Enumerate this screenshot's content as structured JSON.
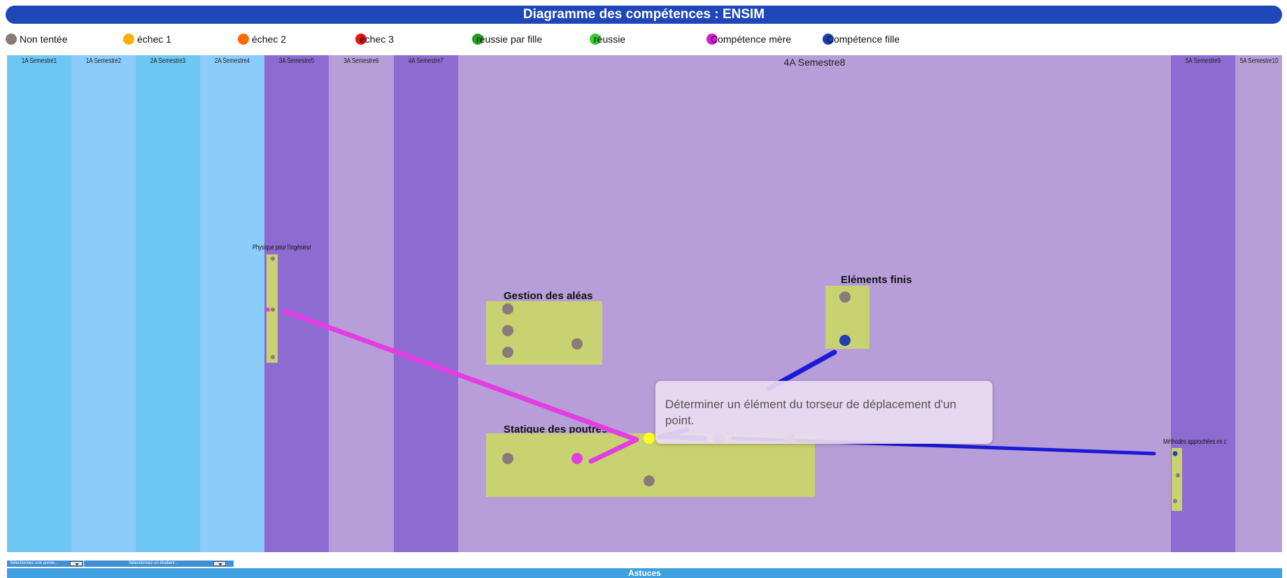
{
  "app": {
    "title": "Diagramme des compétences : ENSIM"
  },
  "legend": [
    {
      "label": "Non tentée",
      "color": "#8a7a78"
    },
    {
      "label": "échec 1",
      "color": "#ffb000"
    },
    {
      "label": "échec 2",
      "color": "#ff6a00"
    },
    {
      "label": "échec 3",
      "color": "#ee1111"
    },
    {
      "label": "réussie par fille",
      "color": "#22a020"
    },
    {
      "label": "réussie",
      "color": "#33cc33"
    },
    {
      "label": "Compétence mère",
      "color": "#d11ed1"
    },
    {
      "label": "Compétence fille",
      "color": "#1f3fb0"
    }
  ],
  "semesters": [
    {
      "label": "1A Semestre1",
      "color": "#6ec6f2"
    },
    {
      "label": "1A Semestre2",
      "color": "#8cccfb"
    },
    {
      "label": "2A Semestre3",
      "color": "#6ec6f2"
    },
    {
      "label": "2A Semestre4",
      "color": "#8cccfb"
    },
    {
      "label": "3A Semestre5",
      "color": "#8d6bd0"
    },
    {
      "label": "3A Semestre6",
      "color": "#b89ed8"
    },
    {
      "label": "4A Semestre7",
      "color": "#8d6bd0"
    },
    {
      "label": "4A Semestre8",
      "color": "#b89ed8"
    },
    {
      "label": "5A Semestre9",
      "color": "#8d6bd0"
    },
    {
      "label": "5A Semestre10",
      "color": "#b89ed8"
    }
  ],
  "competences": [
    {
      "title": "Physique pour l'ingénieur"
    },
    {
      "title": "Gestion des aléas"
    },
    {
      "title": "Eléments finis"
    },
    {
      "title": "Statique des poutres"
    },
    {
      "title": "Méthodes approchées en c"
    }
  ],
  "tooltip": {
    "text": "Déterminer un élément du torseur de déplacement d'un point."
  },
  "controls": {
    "year_select": "Sélectionnez une année...",
    "student_select": "Sélectionnez un étudiant..."
  },
  "astuces": {
    "label": "Astuces"
  }
}
